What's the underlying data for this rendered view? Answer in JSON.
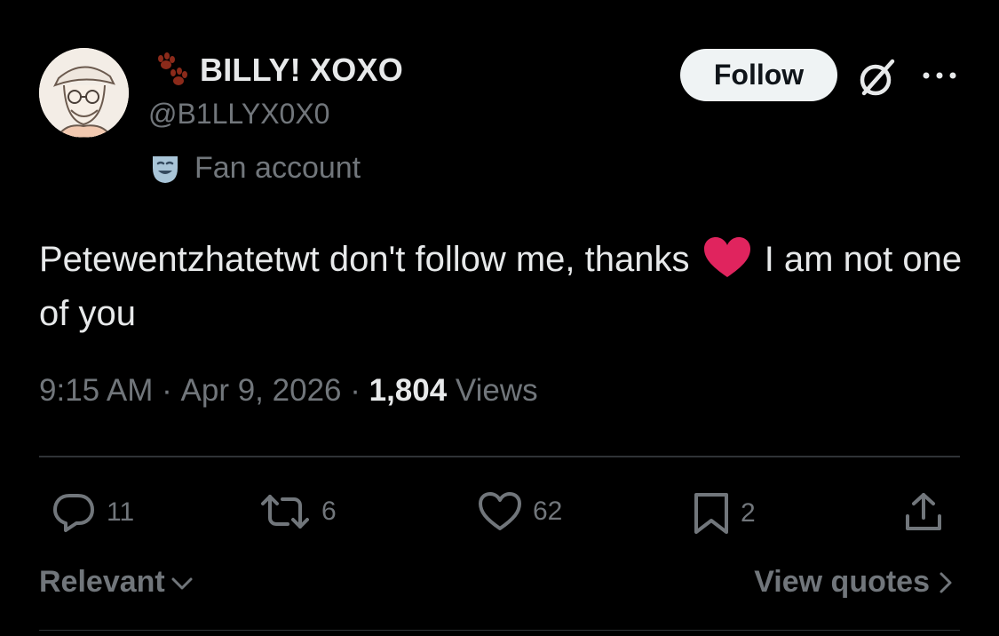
{
  "author": {
    "display_name": "BILLY! XOXO",
    "handle": "@B1LLYX0X0",
    "badge_label": "Fan account",
    "badge_icon": "theater-mask-icon",
    "name_emoji": "paw-prints-icon"
  },
  "header": {
    "follow_label": "Follow",
    "grok_icon": "grok-icon",
    "more_icon": "more-icon"
  },
  "tweet": {
    "text_before_emoji": "Petewentzhatetwt don't follow me, thanks ",
    "emoji": "red-heart-icon",
    "text_after_emoji": " I am not one of you"
  },
  "meta": {
    "time": "9:15 AM",
    "separator": " · ",
    "date": "Apr 9, 2026",
    "views_count": "1,804",
    "views_label": " Views"
  },
  "actions": {
    "replies": "11",
    "reposts": "6",
    "likes": "62",
    "bookmarks": "2"
  },
  "footer": {
    "sort_label": "Relevant",
    "view_quotes_label": "View quotes"
  },
  "colors": {
    "background": "#000000",
    "primary_text": "#e7e9ea",
    "secondary_text": "#71767b",
    "divider": "#2f3336",
    "follow_bg": "#eff3f4",
    "heart": "#e0245e"
  }
}
